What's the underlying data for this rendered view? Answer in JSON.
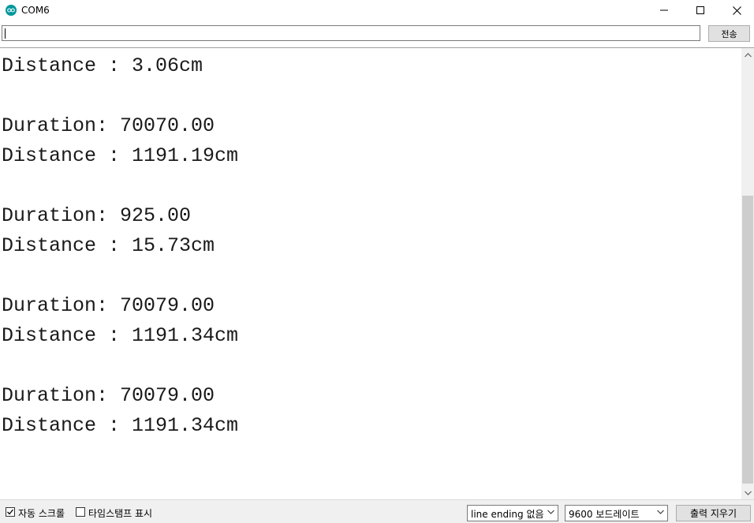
{
  "window": {
    "title": "COM6",
    "icon": "arduino-icon"
  },
  "send": {
    "input_value": "",
    "button_label": "전송"
  },
  "output": {
    "lines": [
      "Distance : 3.06cm",
      "",
      "Duration: 70070.00",
      "Distance : 1191.19cm",
      "",
      "Duration: 925.00",
      "Distance : 15.73cm",
      "",
      "Duration: 70079.00",
      "Distance : 1191.34cm",
      "",
      "Duration: 70079.00",
      "Distance : 1191.34cm"
    ]
  },
  "status": {
    "autoscroll_label": "자동 스크롤",
    "autoscroll_checked": true,
    "timestamp_label": "타임스탬프 표시",
    "timestamp_checked": false,
    "line_ending_value": "line ending 없음",
    "baud_value": "9600 보드레이트",
    "clear_label": "출력 지우기"
  },
  "colors": {
    "accent": "#00979c"
  }
}
